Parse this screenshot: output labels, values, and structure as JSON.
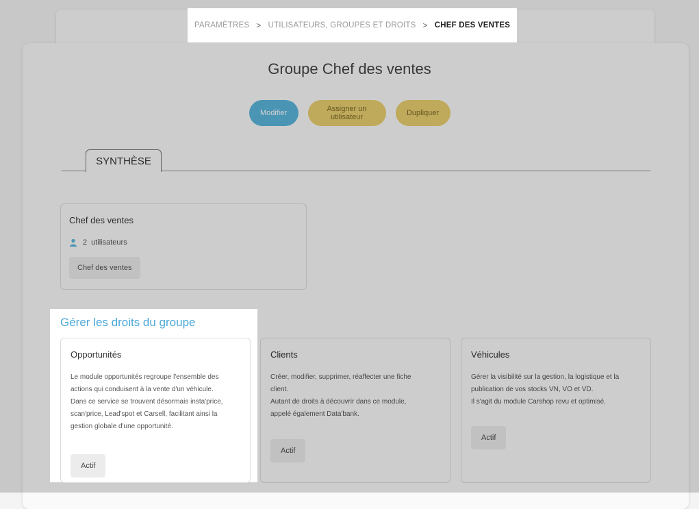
{
  "breadcrumb": {
    "item1": "PARAMÈTRES",
    "item2": "UTILISATEURS, GROUPES ET DROITS",
    "current": "CHEF DES VENTES",
    "separator": ">"
  },
  "page": {
    "title": "Groupe Chef des ventes"
  },
  "actions": {
    "edit": "Modifier",
    "assign": "Assigner un utilisateur",
    "duplicate": "Dupliquer"
  },
  "tabs": {
    "active": "SYNTHÈSE"
  },
  "summary": {
    "group_name": "Chef des ventes",
    "user_count": "2",
    "user_label": "utilisateurs",
    "tag": "Chef des ventes",
    "user_icon": "user-icon"
  },
  "rights": {
    "section_title": "Gérer les droits du groupe",
    "modules": [
      {
        "title": "Opportunités",
        "lines": [
          "Le module opportunités regroupe l'ensemble des",
          "actions qui conduisent à la vente d'un véhicule.",
          "Dans ce service se trouvent désormais insta'price,",
          "scan'price, Lead'spot et Carsell, facilitant ainsi la",
          "gestion globale d'une opportunité."
        ],
        "status": "Actif"
      },
      {
        "title": "Clients",
        "lines": [
          "Créer, modifier, supprimer, réaffecter une fiche",
          "client.",
          "Autant de droits à découvrir dans ce module,",
          "appelé également Data'bank."
        ],
        "status": "Actif"
      },
      {
        "title": "Véhicules",
        "lines": [
          "Gérer la visibilité sur la gestion, la logistique et la",
          "publication de vos stocks VN, VO et VD.",
          "Il s'agit du module Carshop revu et optimisé."
        ],
        "status": "Actif"
      }
    ]
  },
  "colors": {
    "accent_blue": "#5bb6dc",
    "accent_yellow": "#e9cf6e",
    "section_title": "#4aa8d8"
  }
}
